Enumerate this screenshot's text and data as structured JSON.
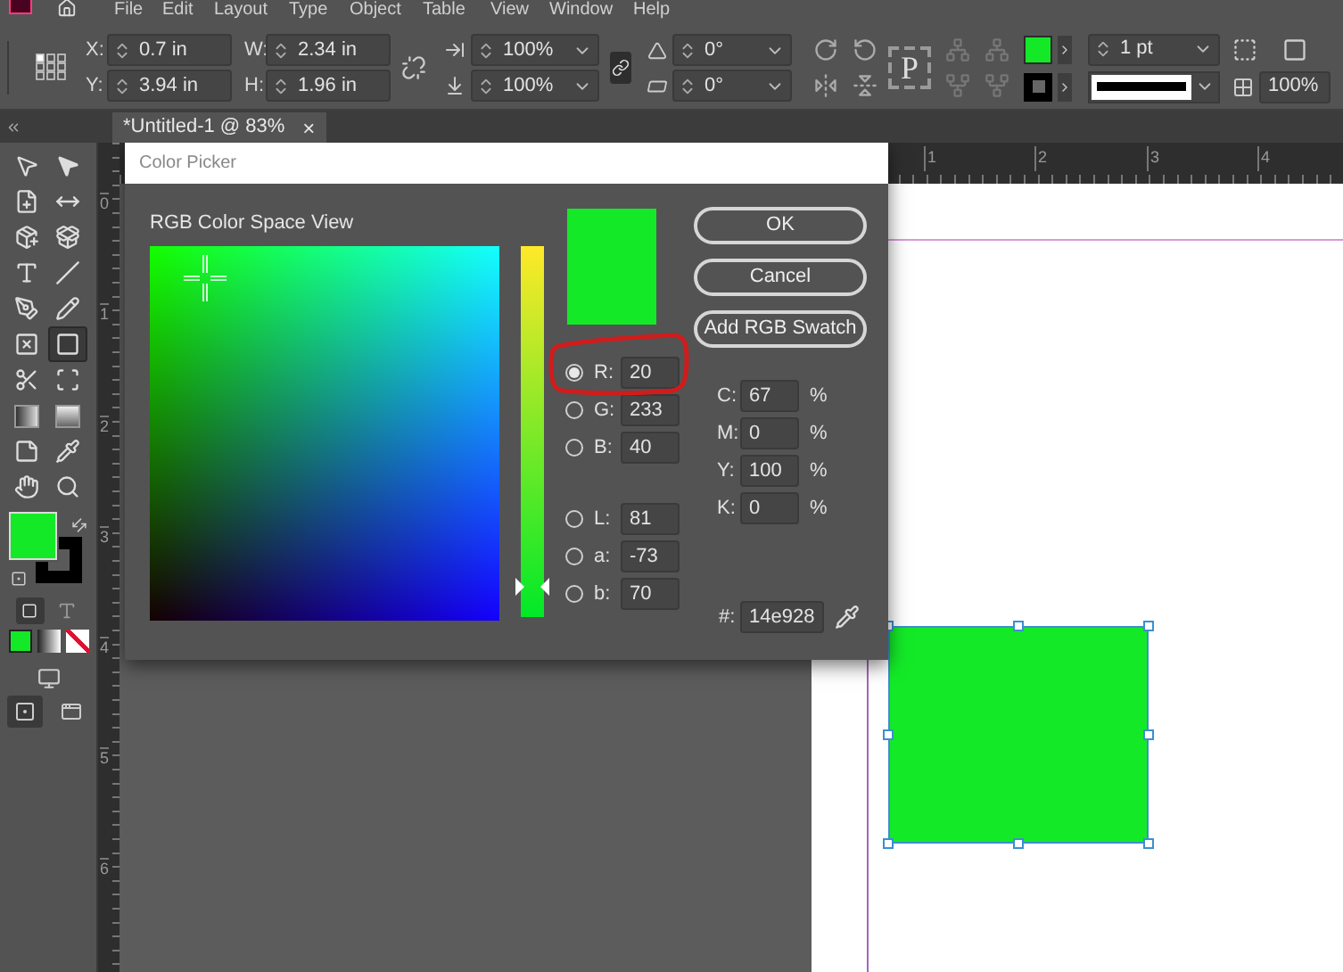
{
  "menu_bar": [
    "File",
    "Edit",
    "Layout",
    "Type",
    "Object",
    "Table",
    "View",
    "Window",
    "Help"
  ],
  "control_bar": {
    "position": [
      {
        "label": "X:",
        "value": "0.7 in"
      },
      {
        "label": "Y:",
        "value": "3.94 in"
      }
    ],
    "size": [
      {
        "label": "W:",
        "value": "2.34 in"
      },
      {
        "label": "H:",
        "value": "1.96 in"
      }
    ],
    "scale": [
      "100%",
      "100%"
    ],
    "angles": [
      "0°",
      "0°"
    ],
    "frame_glyph": "P",
    "stroke_weight": "1 pt",
    "opacity": "100%"
  },
  "document_tab": {
    "title": "*Untitled-1 @ 83%",
    "close": "×"
  },
  "tools": [
    {
      "selected": false
    },
    {
      "selected": false
    },
    {
      "selected": false
    },
    {
      "selected": false
    },
    {
      "selected": false
    },
    {
      "selected": false
    },
    {
      "selected": false
    },
    {
      "selected": false
    },
    {
      "selected": false
    },
    {
      "selected": false
    },
    {
      "selected": false
    },
    {
      "selected": true
    },
    {
      "selected": false
    },
    {
      "selected": false
    },
    {
      "selected": false
    },
    {
      "selected": false
    },
    {
      "selected": false
    },
    {
      "selected": false
    },
    {
      "selected": false
    },
    {
      "selected": false
    }
  ],
  "formatting": [
    {
      "selected": true
    },
    {
      "selected": false
    }
  ],
  "view_modes": [
    {
      "selected": true
    },
    {
      "selected": false
    }
  ],
  "vertical_ruler": [
    "0",
    "1",
    "2",
    "3",
    "4",
    "5",
    "6"
  ],
  "horizontal_ruler": [
    "1",
    "2",
    "3",
    "4"
  ],
  "dialog": {
    "title": "Color Picker",
    "view_label": "RGB Color Space View",
    "slider": {
      "level": 0.08
    },
    "buttons": [
      "OK",
      "Cancel",
      "Add RGB Swatch"
    ],
    "channels": [
      {
        "label": "R:",
        "value": "20",
        "selected": true
      },
      {
        "label": "G:",
        "value": "233",
        "selected": false
      },
      {
        "label": "B:",
        "value": "40",
        "selected": false
      },
      {
        "label": "L:",
        "value": "81",
        "selected": false
      },
      {
        "label": "a:",
        "value": "-73",
        "selected": false
      },
      {
        "label": "b:",
        "value": "70",
        "selected": false
      }
    ],
    "cmyk": [
      {
        "label": "C:",
        "value": "67",
        "unit": "%"
      },
      {
        "label": "M:",
        "value": "0",
        "unit": "%"
      },
      {
        "label": "Y:",
        "value": "100",
        "unit": "%"
      },
      {
        "label": "K:",
        "value": "0",
        "unit": "%"
      }
    ],
    "hex": {
      "label": "#:",
      "value": "14e928"
    }
  }
}
